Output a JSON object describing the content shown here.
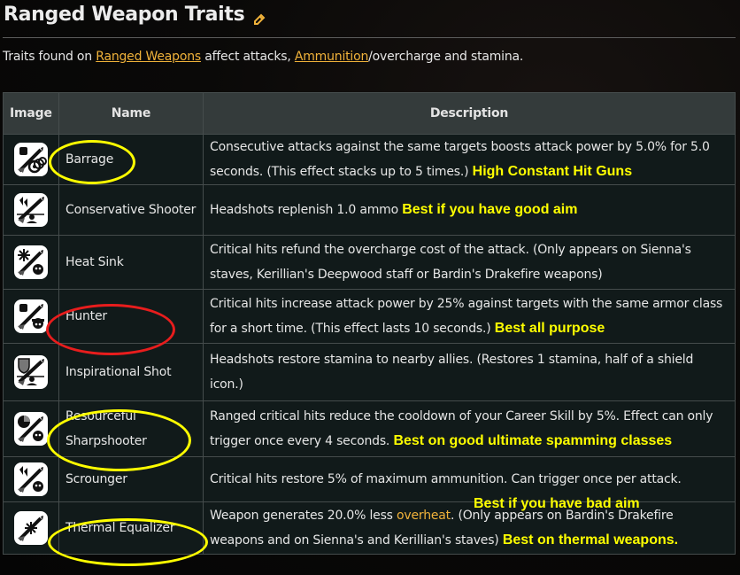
{
  "page": {
    "title": "Ranged Weapon Traits",
    "edit_icon": "pencil-icon",
    "intro": {
      "prefix": "Traits found on ",
      "link1": "Ranged Weapons",
      "middle": " affect attacks, ",
      "link2": "Ammunition",
      "suffix": "/overcharge and stamina."
    }
  },
  "table": {
    "headers": [
      "Image",
      "Name",
      "Description"
    ],
    "rows": [
      {
        "icon": "barrage-trait-icon",
        "name": "Barrage",
        "description": "Consecutive attacks against the same targets boosts attack power by 5.0% for 5.0 seconds. (This effect stacks up to 5 times.)",
        "note": "High Constant Hit Guns",
        "annotation": "yellow-circle"
      },
      {
        "icon": "conservative-shooter-trait-icon",
        "name": "Conservative Shooter",
        "description": "Headshots replenish 1.0 ammo",
        "note": "Best if you have good aim",
        "annotation": ""
      },
      {
        "icon": "heat-sink-trait-icon",
        "name": "Heat Sink",
        "description": "Critical hits refund the overcharge cost of the attack. (Only appears on Sienna's staves, Kerillian's Deepwood staff or Bardin's Drakefire weapons)",
        "note": "",
        "annotation": ""
      },
      {
        "icon": "hunter-trait-icon",
        "name": "Hunter",
        "description": "Critical hits increase attack power by 25% against targets with the same armor class for a short time. (This effect lasts 10 seconds.)",
        "note": "Best all purpose",
        "annotation": "red-circle"
      },
      {
        "icon": "inspirational-shot-trait-icon",
        "name": "Inspirational Shot",
        "description": "Headshots restore stamina to nearby allies. (Restores 1 stamina, half of a shield icon.)",
        "note": "",
        "annotation": ""
      },
      {
        "icon": "resourceful-sharpshooter-trait-icon",
        "name": "Resourceful Sharpshooter",
        "description": "Ranged critical hits reduce the cooldown of your Career Skill by 5%. Effect can only trigger once every 4 seconds.",
        "note": "Best on good ultimate spamming classes",
        "annotation": "yellow-circle"
      },
      {
        "icon": "scrounger-trait-icon",
        "name": "Scrounger",
        "description": "Critical hits restore 5% of maximum ammunition. Can trigger once per attack.",
        "note": "Best if you have bad aim",
        "annotation": ""
      },
      {
        "icon": "thermal-equalizer-trait-icon",
        "name": "Thermal Equalizer",
        "description_prefix": "Weapon generates 20.0% less ",
        "description_link": "overheat",
        "description_suffix": ". (Only appears on Bardin's Drakefire weapons and on Sienna's and Kerillian's staves)",
        "note": "Best on thermal weapons.",
        "annotation": "yellow-circle"
      }
    ]
  },
  "colors": {
    "link": "#f0b23a",
    "note": "#ffff00",
    "header_bg": "#343b3b",
    "row_bg": "#111a1a",
    "highlight_yellow": "#ffff00",
    "highlight_red": "#e81d1d"
  }
}
